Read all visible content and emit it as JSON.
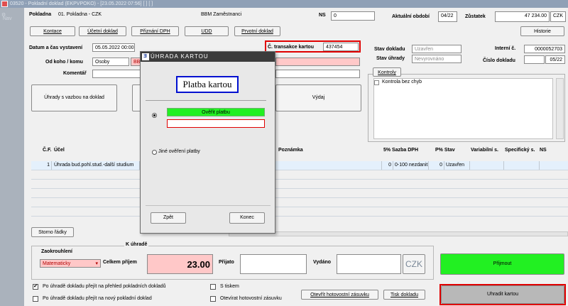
{
  "window": {
    "title": "03520 - Pokladní doklad (EKPVPOKO) - [23.05.2022 07:56] [ ] [ ]"
  },
  "nav": {
    "label": "Nav"
  },
  "header": {
    "pokladna_label": "Pokladna",
    "pokladna_value": "01. Pokladna - CZK",
    "zamestnanci": "BBM Zaměstnanci",
    "ns_label": "NS",
    "ns_value": "0",
    "obdobi_label": "Aktuální období",
    "obdobi_value": "04/22",
    "zustatek_label": "Zůstatek",
    "zustatek_value": "47 234.00",
    "currency": "CZK"
  },
  "toolbar": {
    "kontace": "Kontace",
    "ucetni": "Účetní doklad",
    "priznani": "Přiznání DPH",
    "udd": "UDD",
    "prvotni": "Prvotní doklad",
    "historie": "Historie"
  },
  "form": {
    "datum_label": "Datum a čas vystavení",
    "datum_value": "05.05.2022 00:00",
    "od_koho_label": "Od koho / komu",
    "od_koho_value": "Osoby",
    "od_koho_code": "BB",
    "komentar_label": "Komentář",
    "transakce_label": "Č. transakce kartou",
    "transakce_value": "437454",
    "stav_dokladu_label": "Stav dokladu",
    "stav_dokladu_value": "Uzavřen",
    "stav_uhrady_label": "Stav úhrady",
    "stav_uhrady_value": "Nevyrovnáno",
    "interni_label": "Interní č.",
    "interni_value": "0000052703",
    "cislo_label": "Číslo dokladu",
    "cislo_value": "05/22",
    "uhrady_vazbou": "Úhrady s vazbou na doklad",
    "vydaj": "Výdaj",
    "kontroly_tab": "Kontroly",
    "kontrola_item": "Kontrola bez chyb"
  },
  "grid": {
    "headers": {
      "cf": "Č.F.",
      "ucel": "Účel",
      "poznamka": "Poznámka",
      "sazba": "5% Sazba DPH",
      "stav": "P% Stav",
      "variabilni": "Variabilní s.",
      "specificky": "Specifický s.",
      "ns": "NS"
    },
    "rows": [
      {
        "num": "1",
        "ucel": "Úhrada bud.pohl.stud.-další studium",
        "pct": "0",
        "sazba": "0-100 nezdanit",
        "p": "0",
        "stav": "Uzavřen"
      }
    ],
    "storno": "Storno řádky"
  },
  "payment": {
    "k_uhrade": "K úhradě",
    "zaokrouhleni_label": "Zaokrouhlení",
    "zaokrouhleni_value": "Matematicky",
    "celkem_label": "Celkem příjem",
    "celkem_value": "23.00",
    "prijato_label": "Přijato",
    "vydano_label": "Vydáno",
    "currency_button": "CZK",
    "prijmout": "Přijmout",
    "uhradit_kartou": "Uhradit kartou"
  },
  "options": {
    "prehled": "Po úhradě dokladu přejít na přehled pokladních dokladů",
    "novy": "Po úhradě dokladu přejít na nový pokladní doklad",
    "s_tiskem": "S tiskem",
    "otevirat": "Otevírat hotovostní zásuvku",
    "otevrit_zasuvku": "Otevřít hotovostní zásuvku",
    "tisk": "Tisk dokladu"
  },
  "dialog": {
    "title": "ÚHRADA KARTOU",
    "heading": "Platba kartou",
    "overit": "Ověřit platbu",
    "jine": "Jiné ověření platby",
    "zpet": "Zpět",
    "konec": "Konec"
  },
  "colors": {
    "accent_green": "#22f022",
    "pink": "#ffc8c8",
    "red_highlight": "#e00000",
    "blue_highlight": "#0010d0"
  }
}
